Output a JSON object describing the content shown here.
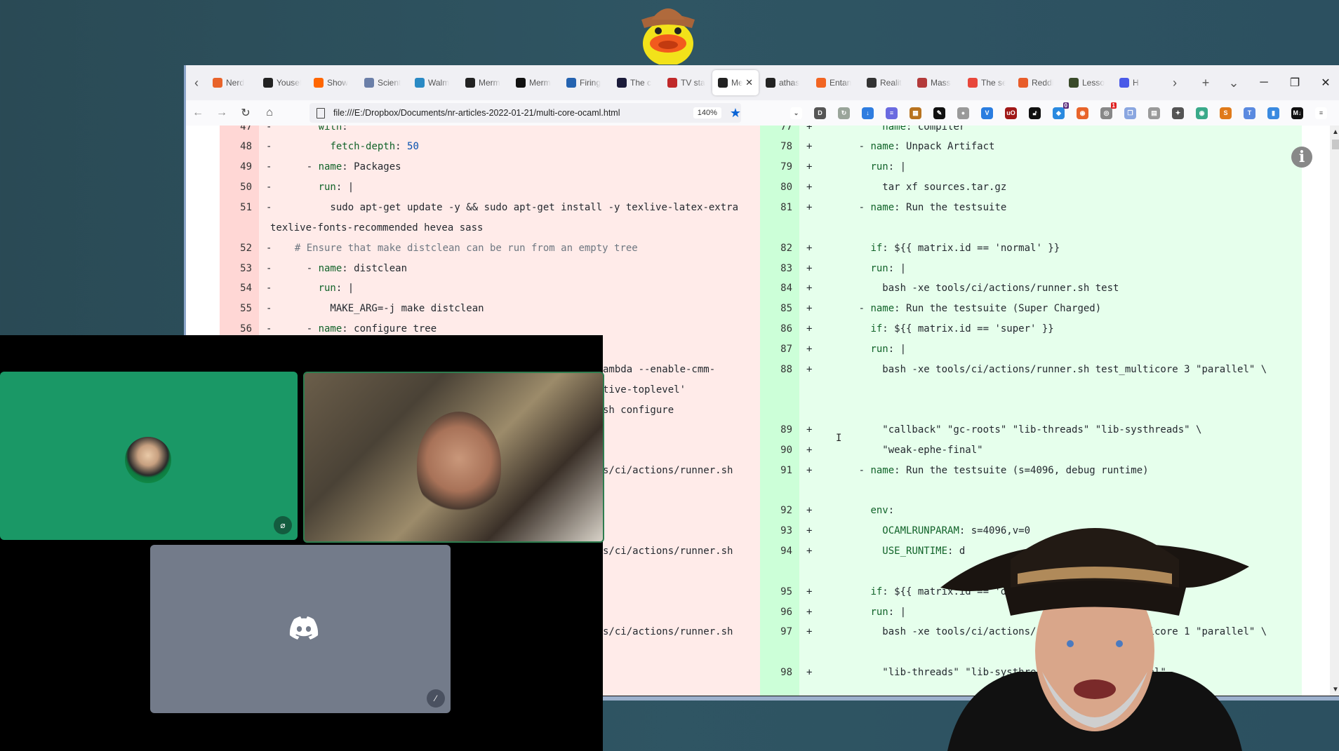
{
  "browser": {
    "tabs": [
      {
        "label": "Nerd",
        "icon": "nerd-favicon",
        "color": "#e8632a"
      },
      {
        "label": "Yousef",
        "icon": "github-icon",
        "color": "#222222"
      },
      {
        "label": "Show",
        "icon": "ycombinator-icon",
        "color": "#ff6600"
      },
      {
        "label": "Scient",
        "icon": "news-icon",
        "color": "#6b7fa8"
      },
      {
        "label": "Walm",
        "icon": "globe-icon",
        "color": "#2a8ac4"
      },
      {
        "label": "Merm",
        "icon": "github-icon",
        "color": "#222222"
      },
      {
        "label": "Merm",
        "icon": "medium-icon",
        "color": "#111111"
      },
      {
        "label": "Firing",
        "icon": "nbc4-icon",
        "color": "#2563b0"
      },
      {
        "label": "The c",
        "icon": "lambda-icon",
        "color": "#1b1b3a"
      },
      {
        "label": "TV sta",
        "icon": "tv-icon",
        "color": "#c0292a"
      },
      {
        "label": "Me",
        "icon": "github-icon",
        "color": "#222222",
        "active": true
      },
      {
        "label": "athas",
        "icon": "github-icon",
        "color": "#222222"
      },
      {
        "label": "Entan",
        "icon": "ars-icon",
        "color": "#f26522"
      },
      {
        "label": "Realit",
        "icon": "ai-icon",
        "color": "#333333"
      },
      {
        "label": "Mass",
        "icon": "shield-crest-icon",
        "color": "#b33a3a"
      },
      {
        "label": "The se",
        "icon": "s-icon",
        "color": "#e8473b"
      },
      {
        "label": "Reddi",
        "icon": "g-circle-icon",
        "color": "#e85d2a"
      },
      {
        "label": "Lesso",
        "icon": "rcd-icon",
        "color": "#3a4a2a"
      },
      {
        "label": "H",
        "icon": "grid-icon",
        "color": "#4a5ae8"
      }
    ],
    "new_tab": "+",
    "tab_list": "⌄",
    "scroll_left": "‹",
    "scroll_right": "›",
    "window_controls": {
      "minimize": "─",
      "restore": "❐",
      "close": "✕"
    },
    "url": "file:///E:/Dropbox/Documents/nr-articles-2022-01-21/multi-core-ocaml.html",
    "zoom": "140%",
    "extensions": [
      {
        "name": "pocket-icon",
        "color": "#ffffff",
        "glyph": "⌄",
        "fg": "#555"
      },
      {
        "name": "d-icon",
        "color": "#555555",
        "glyph": "D"
      },
      {
        "name": "folder-sync-icon",
        "color": "#9aa59a",
        "glyph": "↻"
      },
      {
        "name": "file-download-icon",
        "color": "#2f7de0",
        "glyph": "↓"
      },
      {
        "name": "stack-icon",
        "color": "#6a6ae0",
        "glyph": "≡"
      },
      {
        "name": "grid-app-icon",
        "color": "#b8731f",
        "glyph": "▦"
      },
      {
        "name": "pen-icon",
        "color": "#111111",
        "glyph": "✎"
      },
      {
        "name": "moon-icon",
        "color": "#9a9a9a",
        "glyph": "●"
      },
      {
        "name": "v-icon",
        "color": "#2a7de0",
        "glyph": "V"
      },
      {
        "name": "ublock-icon",
        "color": "#a01818",
        "glyph": "uO"
      },
      {
        "name": "lock-icon",
        "color": "#111111",
        "glyph": "🔓︎"
      },
      {
        "name": "tag-icon",
        "color": "#2a8ae0",
        "glyph": "◆",
        "badge": "0",
        "badge_color": "#5a2a7a"
      },
      {
        "name": "duckduckgo-icon",
        "color": "#e8642a",
        "glyph": "◉"
      },
      {
        "name": "disk-icon",
        "color": "#888888",
        "glyph": "◎",
        "badge": "1",
        "badge_color": "#e02020"
      },
      {
        "name": "copy-icon",
        "color": "#8aa6e0",
        "glyph": "❐"
      },
      {
        "name": "panel-icon",
        "color": "#9a9a9a",
        "glyph": "▤"
      },
      {
        "name": "cat-icon",
        "color": "#555555",
        "glyph": "✦"
      },
      {
        "name": "circle-icon",
        "color": "#3aaa8a",
        "glyph": "◉"
      },
      {
        "name": "s-box-icon",
        "color": "#e07a1a",
        "glyph": "S"
      },
      {
        "name": "t-icon",
        "color": "#5a8ae0",
        "glyph": "T"
      },
      {
        "name": "zip-icon",
        "color": "#3a8ae0",
        "glyph": "▮"
      },
      {
        "name": "markdown-icon",
        "color": "#111111",
        "glyph": "M↓"
      },
      {
        "name": "menu-icon",
        "color": "#ffffff",
        "glyph": "≡",
        "fg": "#555"
      }
    ]
  },
  "diff": {
    "left": [
      {
        "n": "47",
        "sign": "-",
        "parts": [
          [
            "",
            "      "
          ],
          [
            "key",
            "with"
          ],
          [
            "",
            ":"
          ]
        ]
      },
      {
        "n": "48",
        "sign": "-",
        "parts": [
          [
            "",
            "        "
          ],
          [
            "key",
            "fetch-depth"
          ],
          [
            "",
            ": "
          ],
          [
            "num",
            "50"
          ]
        ]
      },
      {
        "n": "49",
        "sign": "-",
        "parts": [
          [
            "",
            "    - "
          ],
          [
            "key",
            "name"
          ],
          [
            "",
            ": Packages"
          ]
        ]
      },
      {
        "n": "50",
        "sign": "-",
        "parts": [
          [
            "",
            "      "
          ],
          [
            "key",
            "run"
          ],
          [
            "",
            ": |"
          ]
        ]
      },
      {
        "n": "51",
        "sign": "-",
        "parts": [
          [
            "",
            "        sudo apt-get update -y && sudo apt-get install -y texlive-latex-extra"
          ]
        ]
      },
      {
        "n": "",
        "sign": "",
        "parts": [
          [
            "",
            "texlive-fonts-recommended hevea sass"
          ]
        ],
        "wrap": true
      },
      {
        "n": "52",
        "sign": "-",
        "parts": [
          [
            "",
            "  "
          ],
          [
            "cmt",
            "# Ensure that make distclean can be run from an empty tree"
          ]
        ]
      },
      {
        "n": "53",
        "sign": "-",
        "parts": [
          [
            "",
            "    - "
          ],
          [
            "key",
            "name"
          ],
          [
            "",
            ": distclean"
          ]
        ]
      },
      {
        "n": "54",
        "sign": "-",
        "parts": [
          [
            "",
            "      "
          ],
          [
            "key",
            "run"
          ],
          [
            "",
            ": |"
          ]
        ]
      },
      {
        "n": "55",
        "sign": "-",
        "parts": [
          [
            "",
            "        MAKE_ARG=-j make distclean"
          ]
        ]
      },
      {
        "n": "56",
        "sign": "-",
        "parts": [
          [
            "",
            "    - "
          ],
          [
            "key",
            "name"
          ],
          [
            "",
            ": configure tree"
          ]
        ]
      }
    ],
    "left_hidden_fragments": [
      "ambda --enable-cmm-",
      "tive-toplevel'",
      "sh configure",
      "s/ci/actions/runner.sh",
      "s/ci/actions/runner.sh",
      "s/ci/actions/runner.sh"
    ],
    "right": [
      {
        "n": "77",
        "sign": "+",
        "parts": [
          [
            "",
            "          "
          ],
          [
            "key",
            "name"
          ],
          [
            "",
            ": compiler"
          ]
        ]
      },
      {
        "n": "78",
        "sign": "+",
        "parts": [
          [
            "",
            "      - "
          ],
          [
            "key",
            "name"
          ],
          [
            "",
            ": Unpack Artifact"
          ]
        ]
      },
      {
        "n": "79",
        "sign": "+",
        "parts": [
          [
            "",
            "        "
          ],
          [
            "key",
            "run"
          ],
          [
            "",
            ": |"
          ]
        ]
      },
      {
        "n": "80",
        "sign": "+",
        "parts": [
          [
            "",
            "          tar xf sources.tar.gz"
          ]
        ]
      },
      {
        "n": "81",
        "sign": "+",
        "parts": [
          [
            "",
            "      - "
          ],
          [
            "key",
            "name"
          ],
          [
            "",
            ": Run the testsuite"
          ]
        ]
      },
      {
        "n": "82",
        "sign": "+",
        "parts": [
          [
            "",
            "        "
          ],
          [
            "key",
            "if"
          ],
          [
            "",
            ": ${{ matrix.id == 'normal' }}"
          ]
        ]
      },
      {
        "n": "83",
        "sign": "+",
        "parts": [
          [
            "",
            "        "
          ],
          [
            "key",
            "run"
          ],
          [
            "",
            ": |"
          ]
        ]
      },
      {
        "n": "84",
        "sign": "+",
        "parts": [
          [
            "",
            "          bash -xe tools/ci/actions/runner.sh test"
          ]
        ]
      },
      {
        "n": "85",
        "sign": "+",
        "parts": [
          [
            "",
            "      - "
          ],
          [
            "key",
            "name"
          ],
          [
            "",
            ": Run the testsuite (Super Charged)"
          ]
        ]
      },
      {
        "n": "86",
        "sign": "+",
        "parts": [
          [
            "",
            "        "
          ],
          [
            "key",
            "if"
          ],
          [
            "",
            ": ${{ matrix.id == 'super' }}"
          ]
        ]
      },
      {
        "n": "87",
        "sign": "+",
        "parts": [
          [
            "",
            "        "
          ],
          [
            "key",
            "run"
          ],
          [
            "",
            ": |"
          ]
        ]
      },
      {
        "n": "88",
        "sign": "+",
        "parts": [
          [
            "",
            "          bash -xe tools/ci/actions/runner.sh test_multicore 3 \"parallel\" \\"
          ]
        ]
      },
      {
        "n": "89",
        "sign": "+",
        "parts": [
          [
            "",
            "          \"callback\" \"gc-roots\" \"lib-threads\" \"lib-systhreads\" \\"
          ]
        ]
      },
      {
        "n": "90",
        "sign": "+",
        "parts": [
          [
            "",
            "          \"weak-ephe-final\""
          ]
        ]
      },
      {
        "n": "91",
        "sign": "+",
        "parts": [
          [
            "",
            "      - "
          ],
          [
            "key",
            "name"
          ],
          [
            "",
            ": Run the testsuite (s=4096, debug runtime)"
          ]
        ]
      },
      {
        "n": "92",
        "sign": "+",
        "parts": [
          [
            "",
            "        "
          ],
          [
            "key",
            "env"
          ],
          [
            "",
            ":"
          ]
        ]
      },
      {
        "n": "93",
        "sign": "+",
        "parts": [
          [
            "",
            "          "
          ],
          [
            "key",
            "OCAMLRUNPARAM"
          ],
          [
            "",
            ": s=4096,v=0"
          ]
        ]
      },
      {
        "n": "94",
        "sign": "+",
        "parts": [
          [
            "",
            "          "
          ],
          [
            "key",
            "USE_RUNTIME"
          ],
          [
            "",
            ": d"
          ]
        ]
      },
      {
        "n": "95",
        "sign": "+",
        "parts": [
          [
            "",
            "        "
          ],
          [
            "key",
            "if"
          ],
          [
            "",
            ": ${{ matrix.id == 'debu"
          ]
        ]
      },
      {
        "n": "96",
        "sign": "+",
        "parts": [
          [
            "",
            "        "
          ],
          [
            "key",
            "run"
          ],
          [
            "",
            ": |"
          ]
        ]
      },
      {
        "n": "97",
        "sign": "+",
        "parts": [
          [
            "",
            "          bash -xe tools/ci/actions/runner.sh test_multicore 1 \"parallel\" \\"
          ]
        ]
      },
      {
        "n": "98",
        "sign": "+",
        "parts": [
          [
            "",
            "          \"lib-threads\" \"lib-systhreads\" \"weak-ephe-final\""
          ]
        ]
      }
    ],
    "info_glyph": "i",
    "cursor_glyph": "I"
  },
  "call": {
    "tiles": [
      {
        "name": "participant-avatar-tile",
        "state": "camera-off",
        "icon": "video-off"
      },
      {
        "name": "participant-video-tile",
        "state": "camera-on"
      },
      {
        "name": "participant-discord-tile",
        "state": "no-avatar",
        "icon": "mic-muted"
      }
    ],
    "colors": {
      "green_tile": "#1a9866",
      "grey_tile": "#737b8a"
    }
  }
}
